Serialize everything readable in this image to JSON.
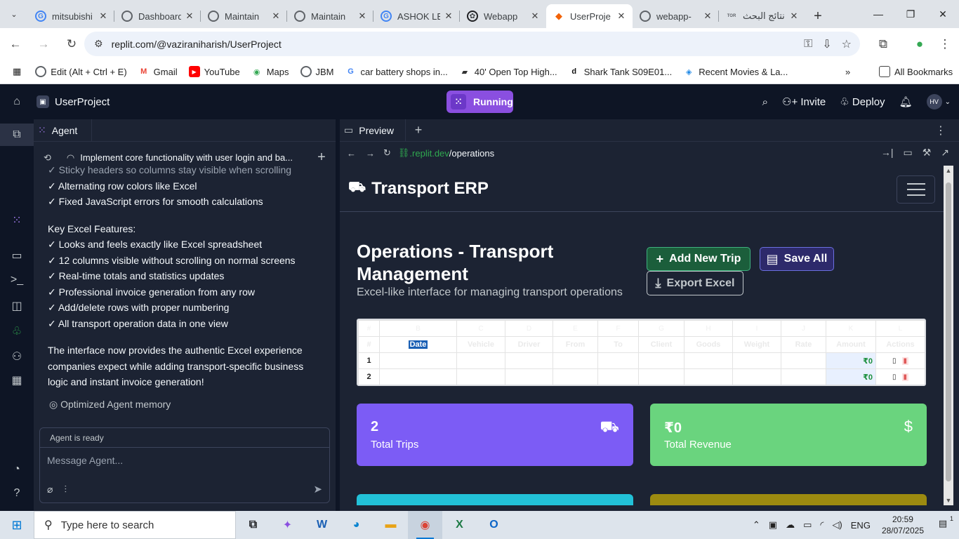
{
  "browser": {
    "tabs": [
      {
        "title": "mitsubishi",
        "icon": "google-icon",
        "color": "#4285f4"
      },
      {
        "title": "Dashboard",
        "icon": "globe-icon",
        "color": "#5f6368"
      },
      {
        "title": "Maintain",
        "icon": "globe-icon",
        "color": "#5f6368"
      },
      {
        "title": "Maintain",
        "icon": "globe-icon",
        "color": "#5f6368"
      },
      {
        "title": "ASHOK LE",
        "icon": "google-icon",
        "color": "#4285f4"
      },
      {
        "title": "Webapp",
        "icon": "chatgpt-icon",
        "color": "#202124"
      },
      {
        "title": "UserProje",
        "icon": "replit-icon",
        "color": "#f26207"
      },
      {
        "title": "webapp-",
        "icon": "globe-icon",
        "color": "#5f6368"
      },
      {
        "title": "نتائج البحث",
        "icon": "site-icon",
        "color": "#5f6368"
      }
    ],
    "active_tab_index": 6,
    "url": "replit.com/@vaziraniharish/UserProject",
    "bookmarks": [
      {
        "label": "Edit (Alt + Ctrl + E)",
        "icon": "globe-icon",
        "color": "#5f6368"
      },
      {
        "label": "Gmail",
        "icon": "gmail-icon",
        "color": "#ea4335"
      },
      {
        "label": "YouTube",
        "icon": "youtube-icon",
        "color": "#ff0000"
      },
      {
        "label": "Maps",
        "icon": "maps-icon",
        "color": "#34a853"
      },
      {
        "label": "JBM",
        "icon": "globe-icon",
        "color": "#5f6368"
      },
      {
        "label": "car battery shops in...",
        "icon": "google-icon",
        "color": "#4285f4"
      },
      {
        "label": "40' Open Top High...",
        "icon": "container-icon",
        "color": "#333333"
      },
      {
        "label": "Shark Tank S09E01...",
        "icon": "d-icon",
        "color": "#111111"
      },
      {
        "label": "Recent Movies & La...",
        "icon": "movie-icon",
        "color": "#1e88e5"
      }
    ],
    "all_bookmarks": "All Bookmarks"
  },
  "replit": {
    "project_name": "UserProject",
    "run_label": "Running",
    "invite_label": "Invite",
    "deploy_label": "Deploy",
    "avatar_initials": "HV",
    "agent": {
      "tab_label": "Agent",
      "thread_title": "Implement core functionality with user login and ba...",
      "lines_top": [
        "✓ Sticky headers so columns stay visible when scrolling",
        "✓ Alternating row colors like Excel",
        "✓ Fixed JavaScript errors for smooth calculations"
      ],
      "features_heading": "Key Excel Features:",
      "features": [
        "✓ Looks and feels exactly like Excel spreadsheet",
        "✓ 12 columns visible without scrolling on normal screens",
        "✓ Real-time totals and statistics updates",
        "✓ Professional invoice generation from any row",
        "✓ Add/delete rows with proper numbering",
        "✓ All transport operation data in one view"
      ],
      "closing": "The interface now provides the authentic Excel experience companies expect while adding transport-specific business logic and instant invoice generation!",
      "memory_note": "Optimized Agent memory",
      "status": "Agent is ready",
      "input_placeholder": "Message Agent..."
    },
    "preview": {
      "tab_label": "Preview",
      "url_domain": ".replit.dev",
      "url_path": "/operations"
    }
  },
  "site": {
    "brand": "Transport ERP",
    "page_title": "Operations - Transport Management",
    "page_subtitle": "Excel-like interface for managing transport operations",
    "buttons": {
      "add_trip": "Add New Trip",
      "save_all": "Save All",
      "export": "Export Excel"
    },
    "sheet": {
      "column_letters": [
        "#",
        "B",
        "C",
        "D",
        "E",
        "F",
        "G",
        "H",
        "I",
        "J",
        "K",
        "L"
      ],
      "field_headers": [
        "#",
        "Date",
        "Vehicle",
        "Driver",
        "From",
        "To",
        "Client",
        "Goods",
        "Weight",
        "Rate",
        "Amount",
        "Actions"
      ],
      "rows": [
        {
          "num": "1",
          "amount": "₹0"
        },
        {
          "num": "2",
          "amount": "₹0"
        }
      ]
    },
    "stats": [
      {
        "value": "2",
        "label": "Total Trips",
        "icon": "truck-icon"
      },
      {
        "value": "₹0",
        "label": "Total Revenue",
        "icon": "dollar-icon"
      }
    ]
  },
  "taskbar": {
    "search_placeholder": "Type here to search",
    "language": "ENG",
    "time": "20:59",
    "date": "28/07/2025",
    "notification_count": "1"
  }
}
